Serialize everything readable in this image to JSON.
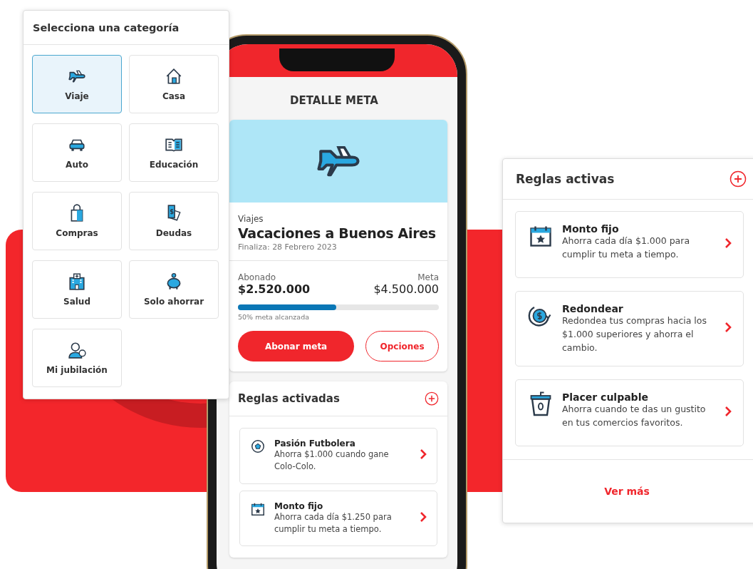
{
  "category_panel": {
    "title": "Selecciona una categoría",
    "categories": [
      {
        "label": "Viaje",
        "selected": true
      },
      {
        "label": "Casa",
        "selected": false
      },
      {
        "label": "Auto",
        "selected": false
      },
      {
        "label": "Educación",
        "selected": false
      },
      {
        "label": "Compras",
        "selected": false
      },
      {
        "label": "Deudas",
        "selected": false
      },
      {
        "label": "Salud",
        "selected": false
      },
      {
        "label": "Solo ahorrar",
        "selected": false
      },
      {
        "label": "Mi jubilación",
        "selected": false
      }
    ]
  },
  "phone": {
    "title": "DETALLE META",
    "goal": {
      "category": "Viajes",
      "name": "Vacaciones a Buenos Aires",
      "end_date": "Finaliza: 28 Febrero 2023",
      "paid_label": "Abonado",
      "paid": "$2.520.000",
      "target_label": "Meta",
      "target": "$4.500.000",
      "level": 0.49,
      "progress_text": "50% meta alcanzada",
      "primary_button": "Abonar meta",
      "secondary_button": "Opciones"
    },
    "rules": {
      "title": "Reglas activadas",
      "items": [
        {
          "title": "Pasión Futbolera",
          "description": "Ahorra $1.000 cuando gane Colo-Colo."
        },
        {
          "title": "Monto fijo",
          "description": "Ahorra cada día $1.250 para cumplir tu meta a tiempo."
        }
      ]
    }
  },
  "rules_panel": {
    "title": "Reglas activas",
    "items": [
      {
        "title": "Monto fijo",
        "description": "Ahorra cada día $1.000 para cumplir tu meta a tiempo."
      },
      {
        "title": "Redondear",
        "description": "Redondea tus compras hacia los $1.000 superiores y ahorra el cambio."
      },
      {
        "title": "Placer culpable",
        "description": "Ahorra cuando te das un gustito en tus comercios favoritos."
      }
    ],
    "link": "Ver más"
  }
}
